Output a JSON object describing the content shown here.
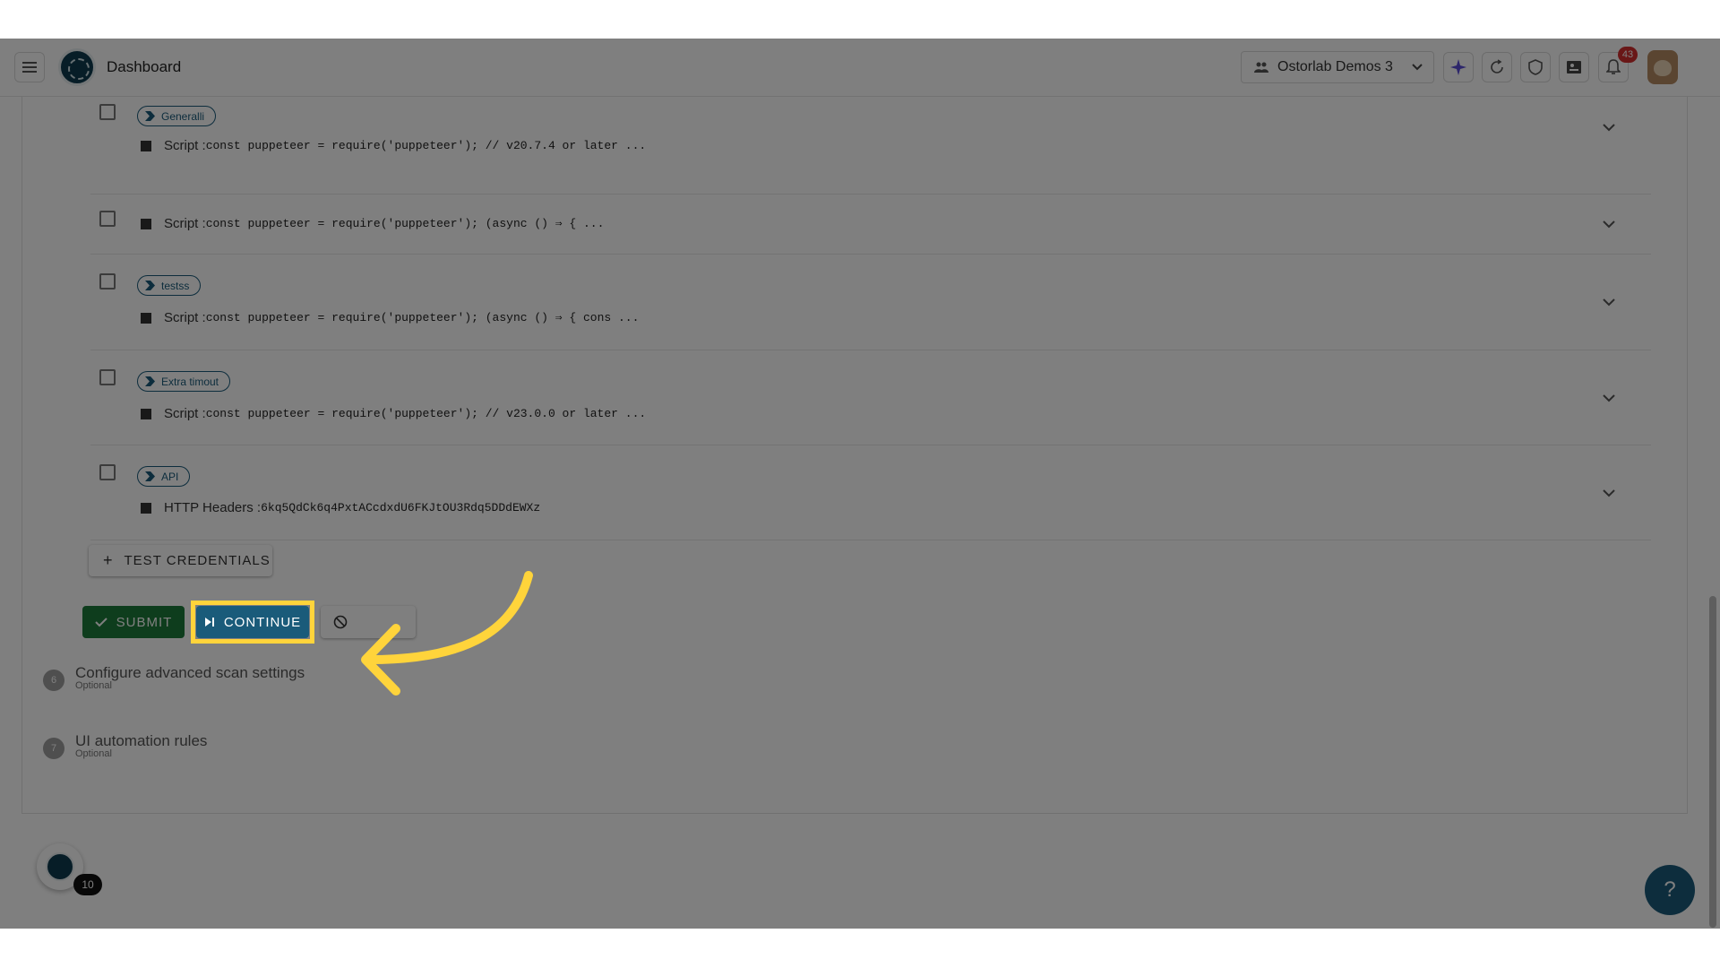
{
  "header": {
    "title": "Dashboard",
    "organization": "Ostorlab Demos 3",
    "notification_count": "43"
  },
  "credentials": [
    {
      "tag": "Generalli",
      "type_label": "Script :",
      "value": "const puppeteer = require('puppeteer'); // v20.7.4 or later ..."
    },
    {
      "tag": "",
      "type_label": "Script :",
      "value": "const puppeteer = require('puppeteer'); (async () ⇒ { ..."
    },
    {
      "tag": "testss",
      "type_label": "Script :",
      "value": "const puppeteer = require('puppeteer'); (async () ⇒ { cons ..."
    },
    {
      "tag": "Extra timout",
      "type_label": "Script :",
      "value": "const puppeteer = require('puppeteer'); // v23.0.0 or later ..."
    },
    {
      "tag": "API",
      "type_label": "HTTP Headers :",
      "value": "6kq5QdCk6q4PxtACcdxdU6FKJtOU3Rdq5DDdEWXz"
    }
  ],
  "actions": {
    "test_credentials": "TEST CREDENTIALS",
    "submit": "SUBMIT",
    "continue": "CONTINUE"
  },
  "steps": [
    {
      "number": "6",
      "title": "Configure advanced scan settings",
      "subtitle": "Optional"
    },
    {
      "number": "7",
      "title": "UI automation rules",
      "subtitle": "Optional"
    }
  ],
  "floating": {
    "count": "10",
    "help": "?"
  },
  "colors": {
    "primary": "#1a5b7a",
    "success": "#1d7a3a",
    "highlight": "#ffd43b",
    "badge": "#d32f2f"
  }
}
